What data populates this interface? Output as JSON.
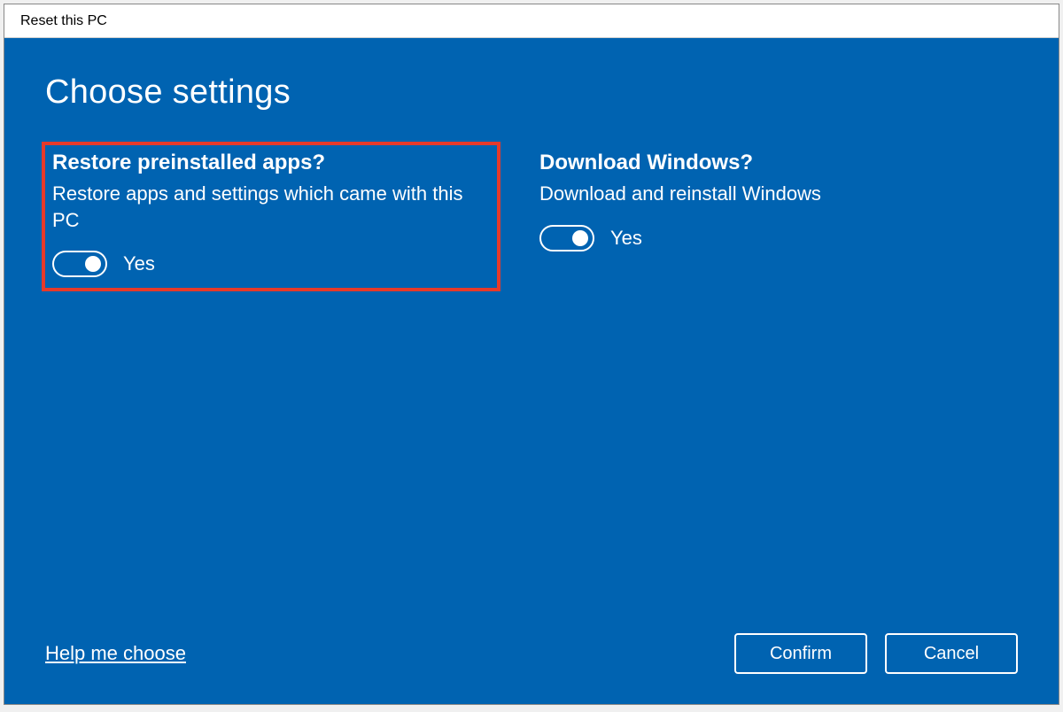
{
  "window": {
    "title": "Reset this PC"
  },
  "main": {
    "heading": "Choose settings",
    "settings": {
      "restore": {
        "title": "Restore preinstalled apps?",
        "description": "Restore apps and settings which came with this PC",
        "toggle_label": "Yes",
        "highlighted": true
      },
      "download": {
        "title": "Download Windows?",
        "description": "Download and reinstall Windows",
        "toggle_label": "Yes",
        "highlighted": false
      }
    },
    "help_link": "Help me choose",
    "buttons": {
      "confirm": "Confirm",
      "cancel": "Cancel"
    }
  }
}
